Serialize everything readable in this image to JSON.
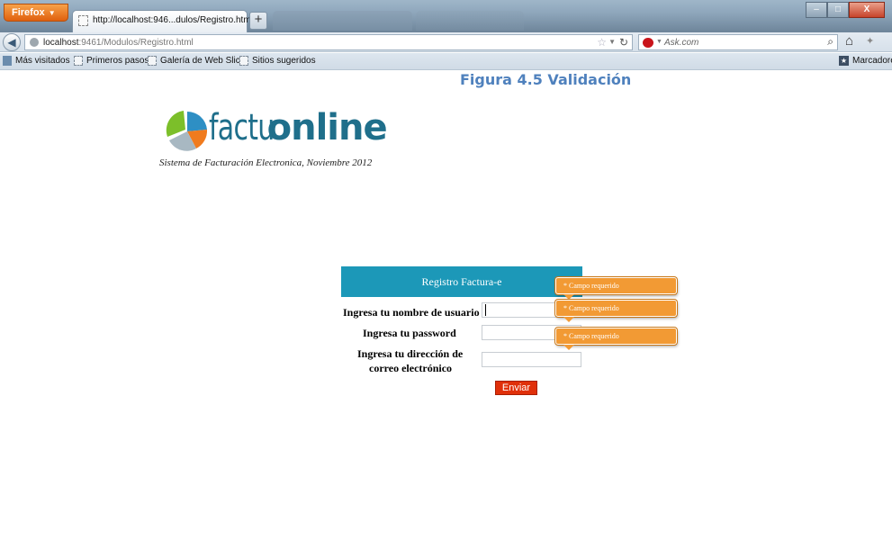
{
  "browser": {
    "menu_label": "Firefox",
    "tab_title": "http://localhost:946...dulos/Registro.html",
    "new_tab_label": "+",
    "url_host": "localhost",
    "url_rest": ":9461/Modulos/Registro.html",
    "search_placeholder": "Ask.com",
    "bookmarks": [
      "Más visitados",
      "Primeros pasos",
      "Galería de Web Slice",
      "Sitios sugeridos"
    ],
    "bookmarks_menu": "Marcadores",
    "window_buttons": {
      "minimize": "–",
      "maximize": "□",
      "close": "X"
    }
  },
  "page": {
    "figure_caption": "Figura 4.5 Validación",
    "logo_light": "factu",
    "logo_bold": "online",
    "subtitle": "Sistema de Facturación Electronica, Noviembre 2012",
    "form": {
      "title": "Registro Factura-e",
      "username_label": "Ingresa tu nombre de usuario",
      "password_label": "Ingresa tu password",
      "email_label_line1": "Ingresa tu dirección de",
      "email_label_line2": "correo electrónico",
      "username_value": "",
      "password_value": "",
      "email_value": "",
      "submit_label": "Enviar"
    },
    "validation": {
      "username_error": "* Campo requerido",
      "password_error": "* Campo requerido",
      "email_error": "* Campo requerido"
    }
  },
  "colors": {
    "form_header": "#1c98b8",
    "submit_button": "#e0300a",
    "tooltip": "#f29a34",
    "caption": "#4f81bd",
    "logo": "#1f6f8b"
  }
}
